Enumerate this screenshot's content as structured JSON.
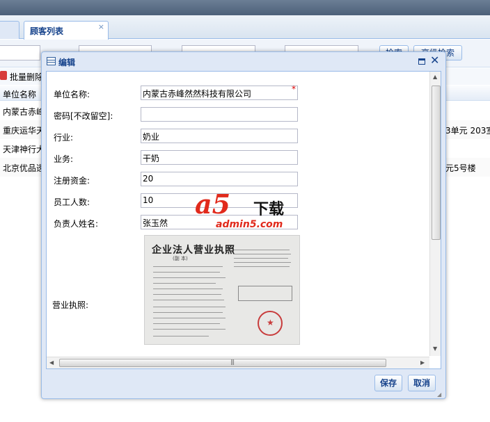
{
  "tabs": {
    "active_label": "顾客列表",
    "close_glyph": "×"
  },
  "search": {
    "buttons": [
      "检索",
      "高级检索"
    ]
  },
  "toolbar": {
    "batch_delete": "批量删除"
  },
  "grid": {
    "header": "单位名称",
    "rows": [
      {
        "name": "内蒙古赤峰",
        "addr": ""
      },
      {
        "name": "重庆运华天",
        "addr": "3单元 203室"
      },
      {
        "name": "天津神行大",
        "addr": ""
      },
      {
        "name": "北京优品透",
        "addr": "元5号楼"
      }
    ]
  },
  "dialog": {
    "title": "编辑",
    "fields": [
      {
        "label": "单位名称:",
        "value": "内蒙古赤峰然然科技有限公司",
        "required": "*"
      },
      {
        "label": "密码[不改留空]:",
        "value": ""
      },
      {
        "label": "行业:",
        "value": "奶业"
      },
      {
        "label": "业务:",
        "value": "干奶"
      },
      {
        "label": "注册资金:",
        "value": "20"
      },
      {
        "label": "员工人数:",
        "value": "10"
      },
      {
        "label": "负责人姓名:",
        "value": "张玉然"
      }
    ],
    "license_label": "营业执照:",
    "license_image": {
      "title": "企业法人营业执照",
      "subtitle": "(副 本)"
    },
    "save": "保存",
    "cancel": "取消"
  },
  "watermark": {
    "logo": "a5",
    "text": "下载",
    "url": "admin5.com"
  },
  "colors": {
    "accent": "#15428b",
    "border": "#99bbe8",
    "required": "#dd0000",
    "watermark_red": "#e12a1c"
  }
}
